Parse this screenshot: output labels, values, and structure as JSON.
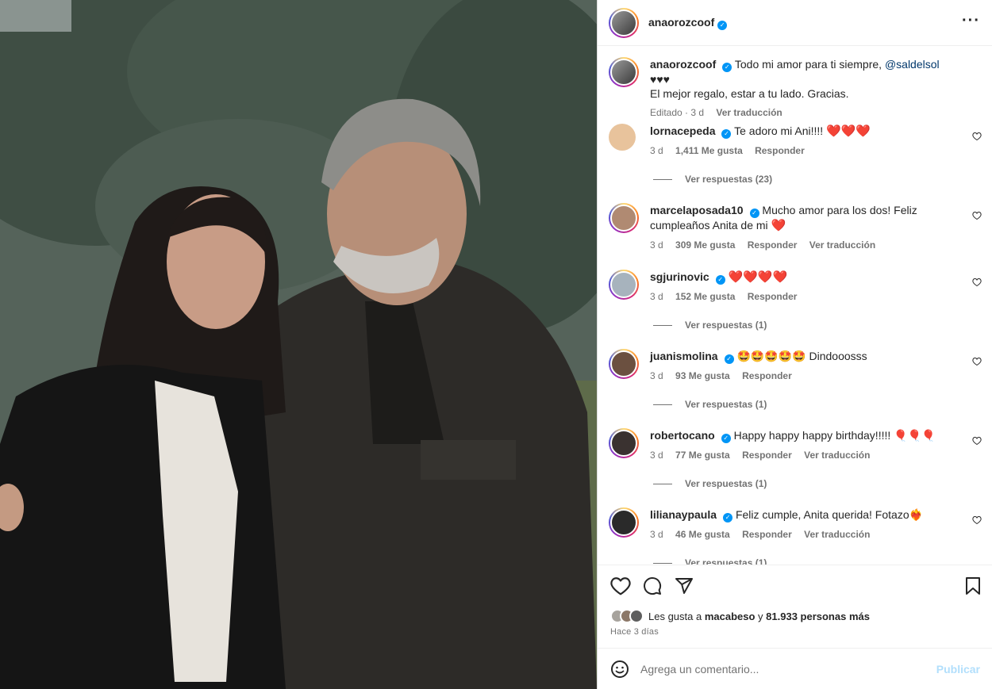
{
  "post": {
    "author": "anaorozcoof",
    "more_icon": "more-horizontal-icon"
  },
  "caption": {
    "author": "anaorozcoof",
    "text_pre": "Todo mi amor para ti siempre, ",
    "mention": "@saldelsol",
    "text_post": " ♥♥♥",
    "line2": "El mejor regalo, estar a tu lado. Gracias.",
    "time": "Editado · 3 d",
    "translate": "Ver traducción"
  },
  "comments": [
    {
      "user": "lornacepeda",
      "text": "Te adoro mi Ani!!!! ",
      "emoji": "❤️❤️❤️",
      "time": "3 d",
      "likes": "1,411 Me gusta",
      "reply": "Responder",
      "translate": "",
      "replies": "Ver respuestas (23)",
      "avatar_color": "#e8c39c"
    },
    {
      "user": "marcelaposada10",
      "text": "Mucho amor para los dos! Feliz cumpleaños Anita de mi ",
      "emoji": "❤️",
      "time": "3 d",
      "likes": "309 Me gusta",
      "reply": "Responder",
      "translate": "Ver traducción",
      "replies": "",
      "avatar_color": "#b08a72"
    },
    {
      "user": "sgjurinovic",
      "text": "",
      "emoji": "❤️❤️❤️❤️",
      "time": "3 d",
      "likes": "152 Me gusta",
      "reply": "Responder",
      "translate": "",
      "replies": "Ver respuestas (1)",
      "avatar_color": "#a7b3bd"
    },
    {
      "user": "juanismolina",
      "text": "",
      "emoji": "🤩🤩🤩🤩🤩 Dindooosss",
      "time": "3 d",
      "likes": "93 Me gusta",
      "reply": "Responder",
      "translate": "",
      "replies": "Ver respuestas (1)",
      "avatar_color": "#6b5040"
    },
    {
      "user": "robertocano",
      "text": "Happy happy happy birthday!!!!! ",
      "emoji": "🎈🎈🎈",
      "time": "3 d",
      "likes": "77 Me gusta",
      "reply": "Responder",
      "translate": "Ver traducción",
      "replies": "Ver respuestas (1)",
      "avatar_color": "#3a3230"
    },
    {
      "user": "lilianaypaula",
      "text": "Feliz cumple, Anita querida! Fotazo",
      "emoji": "❤️‍🔥",
      "time": "3 d",
      "likes": "46 Me gusta",
      "reply": "Responder",
      "translate": "Ver traducción",
      "replies": "Ver respuestas (1)",
      "avatar_color": "#2a2a2a"
    }
  ],
  "actions": {
    "like_icon": "heart-icon",
    "comment_icon": "comment-icon",
    "share_icon": "send-icon",
    "save_icon": "bookmark-icon"
  },
  "likes": {
    "prefix": "Les gusta a ",
    "user": "macabeso",
    "mid": " y ",
    "count": "81.933 personas más"
  },
  "time_ago": "Hace 3 días",
  "composer": {
    "emoji_icon": "smiley-icon",
    "placeholder": "Agrega un comentario...",
    "publish": "Publicar"
  },
  "colors": {
    "verified": "#0095f6",
    "mention": "#00376b",
    "publish_disabled": "#b2dffc",
    "secondary_text": "#737373"
  }
}
